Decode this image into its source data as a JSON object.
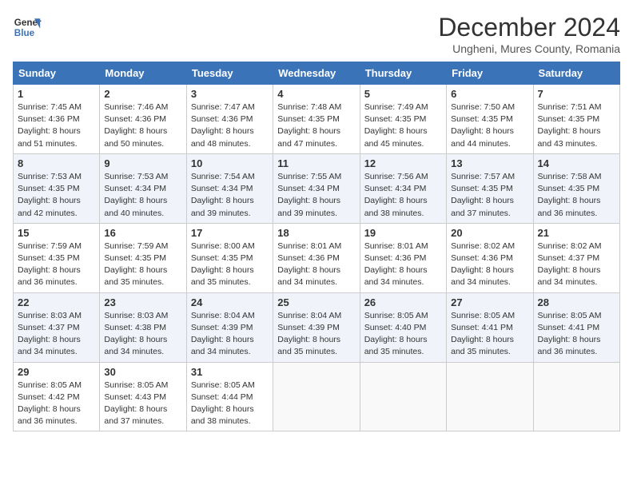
{
  "header": {
    "logo_line1": "General",
    "logo_line2": "Blue",
    "title": "December 2024",
    "subtitle": "Ungheni, Mures County, Romania"
  },
  "weekdays": [
    "Sunday",
    "Monday",
    "Tuesday",
    "Wednesday",
    "Thursday",
    "Friday",
    "Saturday"
  ],
  "weeks": [
    [
      {
        "day": "1",
        "sunrise": "7:45 AM",
        "sunset": "4:36 PM",
        "daylight": "8 hours and 51 minutes."
      },
      {
        "day": "2",
        "sunrise": "7:46 AM",
        "sunset": "4:36 PM",
        "daylight": "8 hours and 50 minutes."
      },
      {
        "day": "3",
        "sunrise": "7:47 AM",
        "sunset": "4:36 PM",
        "daylight": "8 hours and 48 minutes."
      },
      {
        "day": "4",
        "sunrise": "7:48 AM",
        "sunset": "4:35 PM",
        "daylight": "8 hours and 47 minutes."
      },
      {
        "day": "5",
        "sunrise": "7:49 AM",
        "sunset": "4:35 PM",
        "daylight": "8 hours and 45 minutes."
      },
      {
        "day": "6",
        "sunrise": "7:50 AM",
        "sunset": "4:35 PM",
        "daylight": "8 hours and 44 minutes."
      },
      {
        "day": "7",
        "sunrise": "7:51 AM",
        "sunset": "4:35 PM",
        "daylight": "8 hours and 43 minutes."
      }
    ],
    [
      {
        "day": "8",
        "sunrise": "7:53 AM",
        "sunset": "4:35 PM",
        "daylight": "8 hours and 42 minutes."
      },
      {
        "day": "9",
        "sunrise": "7:53 AM",
        "sunset": "4:34 PM",
        "daylight": "8 hours and 40 minutes."
      },
      {
        "day": "10",
        "sunrise": "7:54 AM",
        "sunset": "4:34 PM",
        "daylight": "8 hours and 39 minutes."
      },
      {
        "day": "11",
        "sunrise": "7:55 AM",
        "sunset": "4:34 PM",
        "daylight": "8 hours and 39 minutes."
      },
      {
        "day": "12",
        "sunrise": "7:56 AM",
        "sunset": "4:34 PM",
        "daylight": "8 hours and 38 minutes."
      },
      {
        "day": "13",
        "sunrise": "7:57 AM",
        "sunset": "4:35 PM",
        "daylight": "8 hours and 37 minutes."
      },
      {
        "day": "14",
        "sunrise": "7:58 AM",
        "sunset": "4:35 PM",
        "daylight": "8 hours and 36 minutes."
      }
    ],
    [
      {
        "day": "15",
        "sunrise": "7:59 AM",
        "sunset": "4:35 PM",
        "daylight": "8 hours and 36 minutes."
      },
      {
        "day": "16",
        "sunrise": "7:59 AM",
        "sunset": "4:35 PM",
        "daylight": "8 hours and 35 minutes."
      },
      {
        "day": "17",
        "sunrise": "8:00 AM",
        "sunset": "4:35 PM",
        "daylight": "8 hours and 35 minutes."
      },
      {
        "day": "18",
        "sunrise": "8:01 AM",
        "sunset": "4:36 PM",
        "daylight": "8 hours and 34 minutes."
      },
      {
        "day": "19",
        "sunrise": "8:01 AM",
        "sunset": "4:36 PM",
        "daylight": "8 hours and 34 minutes."
      },
      {
        "day": "20",
        "sunrise": "8:02 AM",
        "sunset": "4:36 PM",
        "daylight": "8 hours and 34 minutes."
      },
      {
        "day": "21",
        "sunrise": "8:02 AM",
        "sunset": "4:37 PM",
        "daylight": "8 hours and 34 minutes."
      }
    ],
    [
      {
        "day": "22",
        "sunrise": "8:03 AM",
        "sunset": "4:37 PM",
        "daylight": "8 hours and 34 minutes."
      },
      {
        "day": "23",
        "sunrise": "8:03 AM",
        "sunset": "4:38 PM",
        "daylight": "8 hours and 34 minutes."
      },
      {
        "day": "24",
        "sunrise": "8:04 AM",
        "sunset": "4:39 PM",
        "daylight": "8 hours and 34 minutes."
      },
      {
        "day": "25",
        "sunrise": "8:04 AM",
        "sunset": "4:39 PM",
        "daylight": "8 hours and 35 minutes."
      },
      {
        "day": "26",
        "sunrise": "8:05 AM",
        "sunset": "4:40 PM",
        "daylight": "8 hours and 35 minutes."
      },
      {
        "day": "27",
        "sunrise": "8:05 AM",
        "sunset": "4:41 PM",
        "daylight": "8 hours and 35 minutes."
      },
      {
        "day": "28",
        "sunrise": "8:05 AM",
        "sunset": "4:41 PM",
        "daylight": "8 hours and 36 minutes."
      }
    ],
    [
      {
        "day": "29",
        "sunrise": "8:05 AM",
        "sunset": "4:42 PM",
        "daylight": "8 hours and 36 minutes."
      },
      {
        "day": "30",
        "sunrise": "8:05 AM",
        "sunset": "4:43 PM",
        "daylight": "8 hours and 37 minutes."
      },
      {
        "day": "31",
        "sunrise": "8:05 AM",
        "sunset": "4:44 PM",
        "daylight": "8 hours and 38 minutes."
      },
      null,
      null,
      null,
      null
    ]
  ]
}
